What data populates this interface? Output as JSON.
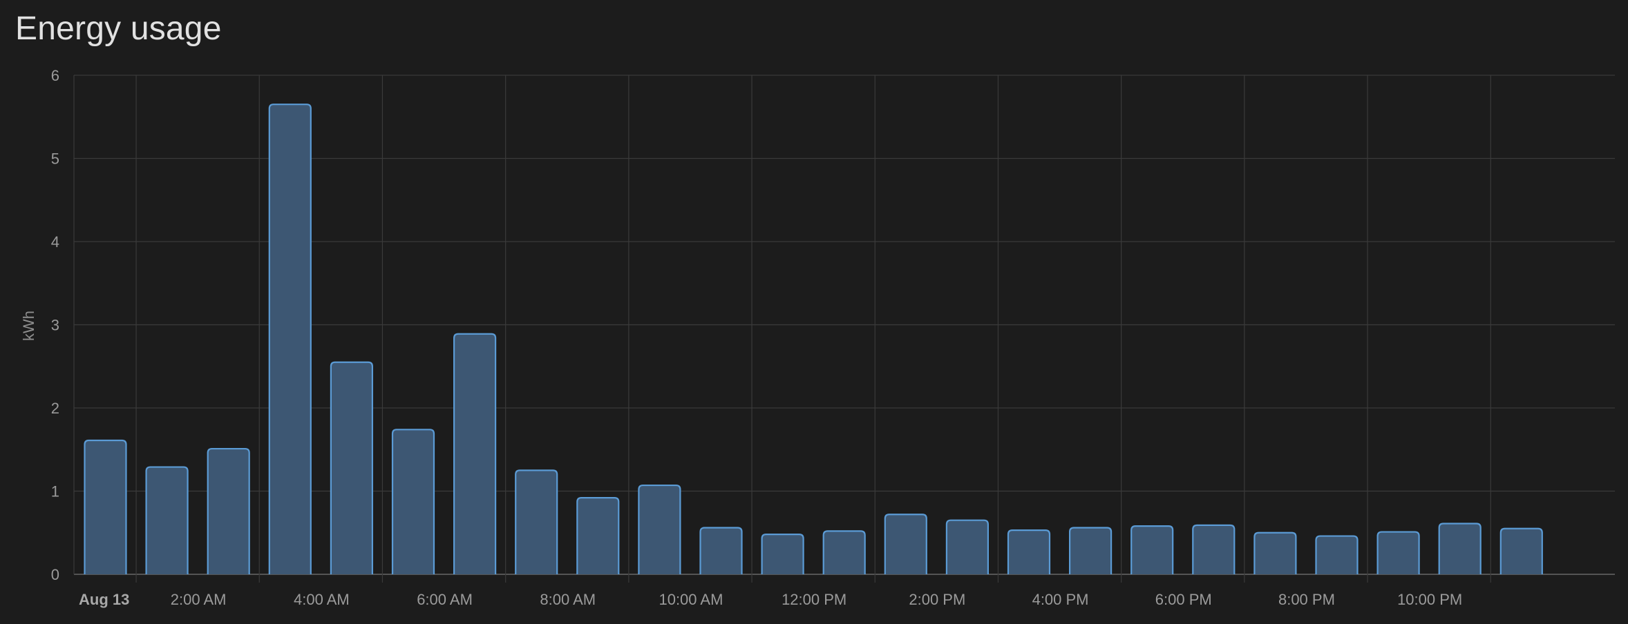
{
  "card": {
    "title": "Energy usage"
  },
  "chart_data": {
    "type": "bar",
    "title": "Energy usage",
    "xlabel": "",
    "ylabel": "kWh",
    "ylim": [
      0,
      6
    ],
    "y_ticks": [
      0,
      1,
      2,
      3,
      4,
      5,
      6
    ],
    "x_tick_labels": [
      "Aug 13",
      "2:00 AM",
      "4:00 AM",
      "6:00 AM",
      "8:00 AM",
      "10:00 AM",
      "12:00 PM",
      "2:00 PM",
      "4:00 PM",
      "6:00 PM",
      "8:00 PM",
      "10:00 PM"
    ],
    "categories": [
      "12:00 AM",
      "1:00 AM",
      "2:00 AM",
      "3:00 AM",
      "4:00 AM",
      "5:00 AM",
      "6:00 AM",
      "7:00 AM",
      "8:00 AM",
      "9:00 AM",
      "10:00 AM",
      "11:00 AM",
      "12:00 PM",
      "1:00 PM",
      "2:00 PM",
      "3:00 PM",
      "4:00 PM",
      "5:00 PM",
      "6:00 PM",
      "7:00 PM",
      "8:00 PM",
      "9:00 PM",
      "10:00 PM",
      "11:00 PM"
    ],
    "values": [
      1.61,
      1.29,
      1.51,
      5.65,
      2.55,
      1.74,
      2.89,
      1.25,
      0.92,
      1.07,
      0.56,
      0.48,
      0.52,
      0.72,
      0.65,
      0.53,
      0.56,
      0.58,
      0.59,
      0.5,
      0.46,
      0.51,
      0.61,
      0.55
    ],
    "grid": true,
    "colors": {
      "bar_fill": "#3d5773",
      "bar_stroke": "#5b9bd5",
      "grid": "#3a3a3a",
      "axis": "#555555"
    }
  }
}
